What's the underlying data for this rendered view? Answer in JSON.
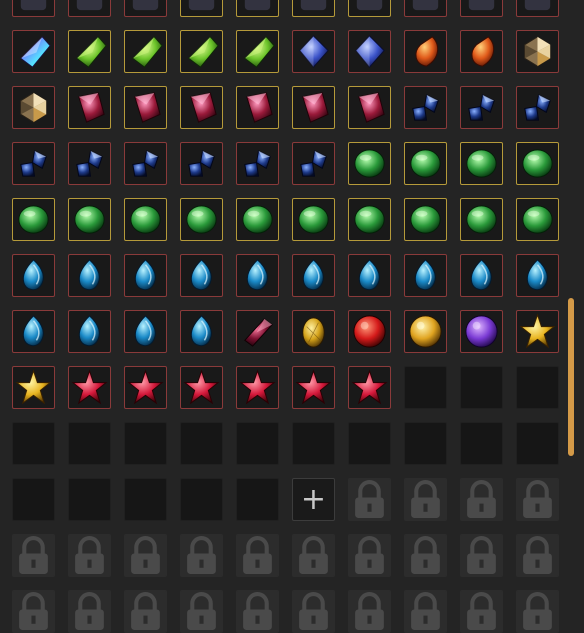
{
  "inventory": {
    "columns": 10,
    "add_slot_label": "+",
    "scroll_position": 0.62,
    "scroll_visible_fraction": 0.26,
    "colors": {
      "background": "#242424",
      "rare_border": "#8a3a3a",
      "epic_border": "#b59a3a",
      "scrollbar": "#d49a48"
    },
    "rows": [
      [
        {
          "state": "filled",
          "icon": "gem-icon-partial",
          "frame": "red"
        },
        {
          "state": "filled",
          "icon": "gem-icon-partial",
          "frame": "red"
        },
        {
          "state": "filled",
          "icon": "gem-icon-partial",
          "frame": "red"
        },
        {
          "state": "filled",
          "icon": "gem-icon-partial",
          "frame": "yellow"
        },
        {
          "state": "filled",
          "icon": "gem-icon-partial",
          "frame": "yellow"
        },
        {
          "state": "filled",
          "icon": "gem-icon-partial",
          "frame": "yellow"
        },
        {
          "state": "filled",
          "icon": "gem-icon-partial",
          "frame": "yellow"
        },
        {
          "state": "filled",
          "icon": "gem-icon-partial",
          "frame": "red"
        },
        {
          "state": "filled",
          "icon": "gem-icon-partial",
          "frame": "red"
        },
        {
          "state": "filled",
          "icon": "gem-icon-partial",
          "frame": "red"
        }
      ],
      [
        {
          "state": "filled",
          "icon": "rainbow-crystal-icon",
          "frame": "red"
        },
        {
          "state": "filled",
          "icon": "green-crystal-icon",
          "frame": "yellow"
        },
        {
          "state": "filled",
          "icon": "green-crystal-icon",
          "frame": "yellow"
        },
        {
          "state": "filled",
          "icon": "green-crystal-icon",
          "frame": "yellow"
        },
        {
          "state": "filled",
          "icon": "green-crystal-icon",
          "frame": "yellow"
        },
        {
          "state": "filled",
          "icon": "blue-diamond-icon",
          "frame": "red"
        },
        {
          "state": "filled",
          "icon": "blue-diamond-icon",
          "frame": "red"
        },
        {
          "state": "filled",
          "icon": "orange-teardrop-gem-icon",
          "frame": "red"
        },
        {
          "state": "filled",
          "icon": "orange-teardrop-gem-icon",
          "frame": "red"
        },
        {
          "state": "filled",
          "icon": "multicolor-gem-icon",
          "frame": "red"
        }
      ],
      [
        {
          "state": "filled",
          "icon": "multicolor-gem-icon",
          "frame": "red"
        },
        {
          "state": "filled",
          "icon": "crimson-crystal-icon",
          "frame": "yellow"
        },
        {
          "state": "filled",
          "icon": "crimson-crystal-icon",
          "frame": "yellow"
        },
        {
          "state": "filled",
          "icon": "crimson-crystal-icon",
          "frame": "yellow"
        },
        {
          "state": "filled",
          "icon": "crimson-crystal-icon",
          "frame": "yellow"
        },
        {
          "state": "filled",
          "icon": "crimson-crystal-icon",
          "frame": "yellow"
        },
        {
          "state": "filled",
          "icon": "crimson-crystal-icon",
          "frame": "yellow"
        },
        {
          "state": "filled",
          "icon": "sapphire-shards-icon",
          "frame": "red"
        },
        {
          "state": "filled",
          "icon": "sapphire-shards-icon",
          "frame": "red"
        },
        {
          "state": "filled",
          "icon": "sapphire-shards-icon",
          "frame": "red"
        }
      ],
      [
        {
          "state": "filled",
          "icon": "sapphire-shards-icon",
          "frame": "red"
        },
        {
          "state": "filled",
          "icon": "sapphire-shards-icon",
          "frame": "red"
        },
        {
          "state": "filled",
          "icon": "sapphire-shards-icon",
          "frame": "red"
        },
        {
          "state": "filled",
          "icon": "sapphire-shards-icon",
          "frame": "red"
        },
        {
          "state": "filled",
          "icon": "sapphire-shards-icon",
          "frame": "red"
        },
        {
          "state": "filled",
          "icon": "sapphire-shards-icon",
          "frame": "red"
        },
        {
          "state": "filled",
          "icon": "emerald-gem-icon",
          "frame": "yellow"
        },
        {
          "state": "filled",
          "icon": "emerald-gem-icon",
          "frame": "yellow"
        },
        {
          "state": "filled",
          "icon": "emerald-gem-icon",
          "frame": "yellow"
        },
        {
          "state": "filled",
          "icon": "emerald-gem-icon",
          "frame": "yellow"
        }
      ],
      [
        {
          "state": "filled",
          "icon": "emerald-gem-icon",
          "frame": "yellow"
        },
        {
          "state": "filled",
          "icon": "emerald-gem-icon",
          "frame": "yellow"
        },
        {
          "state": "filled",
          "icon": "emerald-gem-icon",
          "frame": "yellow"
        },
        {
          "state": "filled",
          "icon": "emerald-gem-icon",
          "frame": "yellow"
        },
        {
          "state": "filled",
          "icon": "emerald-gem-icon",
          "frame": "yellow"
        },
        {
          "state": "filled",
          "icon": "emerald-gem-icon",
          "frame": "yellow"
        },
        {
          "state": "filled",
          "icon": "emerald-gem-icon",
          "frame": "yellow"
        },
        {
          "state": "filled",
          "icon": "emerald-gem-icon",
          "frame": "yellow"
        },
        {
          "state": "filled",
          "icon": "emerald-gem-icon",
          "frame": "yellow"
        },
        {
          "state": "filled",
          "icon": "emerald-gem-icon",
          "frame": "yellow"
        }
      ],
      [
        {
          "state": "filled",
          "icon": "aqua-teardrop-gem-icon",
          "frame": "red"
        },
        {
          "state": "filled",
          "icon": "aqua-teardrop-gem-icon",
          "frame": "red"
        },
        {
          "state": "filled",
          "icon": "aqua-teardrop-gem-icon",
          "frame": "red"
        },
        {
          "state": "filled",
          "icon": "aqua-teardrop-gem-icon",
          "frame": "red"
        },
        {
          "state": "filled",
          "icon": "aqua-teardrop-gem-icon",
          "frame": "red"
        },
        {
          "state": "filled",
          "icon": "aqua-teardrop-gem-icon",
          "frame": "red"
        },
        {
          "state": "filled",
          "icon": "aqua-teardrop-gem-icon",
          "frame": "red"
        },
        {
          "state": "filled",
          "icon": "aqua-teardrop-gem-icon",
          "frame": "red"
        },
        {
          "state": "filled",
          "icon": "aqua-teardrop-gem-icon",
          "frame": "red"
        },
        {
          "state": "filled",
          "icon": "aqua-teardrop-gem-icon",
          "frame": "red"
        }
      ],
      [
        {
          "state": "filled",
          "icon": "aqua-teardrop-gem-icon",
          "frame": "red"
        },
        {
          "state": "filled",
          "icon": "aqua-teardrop-gem-icon",
          "frame": "red"
        },
        {
          "state": "filled",
          "icon": "aqua-teardrop-gem-icon",
          "frame": "red"
        },
        {
          "state": "filled",
          "icon": "aqua-teardrop-gem-icon",
          "frame": "red"
        },
        {
          "state": "filled",
          "icon": "dark-ruby-shard-icon",
          "frame": "red"
        },
        {
          "state": "filled",
          "icon": "golden-egg-gem-icon",
          "frame": "red"
        },
        {
          "state": "filled",
          "icon": "red-orb-icon",
          "frame": "red"
        },
        {
          "state": "filled",
          "icon": "gold-orb-icon",
          "frame": "red"
        },
        {
          "state": "filled",
          "icon": "purple-orb-icon",
          "frame": "red"
        },
        {
          "state": "filled",
          "icon": "gold-star-gem-icon",
          "frame": "red"
        }
      ],
      [
        {
          "state": "filled",
          "icon": "gold-star-gem-icon",
          "frame": "red"
        },
        {
          "state": "filled",
          "icon": "red-star-gem-icon",
          "frame": "red"
        },
        {
          "state": "filled",
          "icon": "red-star-gem-icon",
          "frame": "red"
        },
        {
          "state": "filled",
          "icon": "red-star-gem-icon",
          "frame": "red"
        },
        {
          "state": "filled",
          "icon": "red-star-gem-icon",
          "frame": "red"
        },
        {
          "state": "filled",
          "icon": "red-star-gem-icon",
          "frame": "red"
        },
        {
          "state": "filled",
          "icon": "red-star-gem-icon",
          "frame": "red"
        },
        {
          "state": "empty"
        },
        {
          "state": "empty"
        },
        {
          "state": "empty"
        }
      ],
      [
        {
          "state": "empty"
        },
        {
          "state": "empty"
        },
        {
          "state": "empty"
        },
        {
          "state": "empty"
        },
        {
          "state": "empty"
        },
        {
          "state": "empty"
        },
        {
          "state": "empty"
        },
        {
          "state": "empty"
        },
        {
          "state": "empty"
        },
        {
          "state": "empty"
        }
      ],
      [
        {
          "state": "empty"
        },
        {
          "state": "empty"
        },
        {
          "state": "empty"
        },
        {
          "state": "empty"
        },
        {
          "state": "empty"
        },
        {
          "state": "add"
        },
        {
          "state": "locked",
          "icon": "lock-icon"
        },
        {
          "state": "locked",
          "icon": "lock-icon"
        },
        {
          "state": "locked",
          "icon": "lock-icon"
        },
        {
          "state": "locked",
          "icon": "lock-icon"
        }
      ],
      [
        {
          "state": "locked",
          "icon": "lock-icon"
        },
        {
          "state": "locked",
          "icon": "lock-icon"
        },
        {
          "state": "locked",
          "icon": "lock-icon"
        },
        {
          "state": "locked",
          "icon": "lock-icon"
        },
        {
          "state": "locked",
          "icon": "lock-icon"
        },
        {
          "state": "locked",
          "icon": "lock-icon"
        },
        {
          "state": "locked",
          "icon": "lock-icon"
        },
        {
          "state": "locked",
          "icon": "lock-icon"
        },
        {
          "state": "locked",
          "icon": "lock-icon"
        },
        {
          "state": "locked",
          "icon": "lock-icon"
        }
      ],
      [
        {
          "state": "locked",
          "icon": "lock-icon"
        },
        {
          "state": "locked",
          "icon": "lock-icon"
        },
        {
          "state": "locked",
          "icon": "lock-icon"
        },
        {
          "state": "locked",
          "icon": "lock-icon"
        },
        {
          "state": "locked",
          "icon": "lock-icon"
        },
        {
          "state": "locked",
          "icon": "lock-icon"
        },
        {
          "state": "locked",
          "icon": "lock-icon"
        },
        {
          "state": "locked",
          "icon": "lock-icon"
        },
        {
          "state": "locked",
          "icon": "lock-icon"
        },
        {
          "state": "locked",
          "icon": "lock-icon"
        }
      ]
    ]
  }
}
